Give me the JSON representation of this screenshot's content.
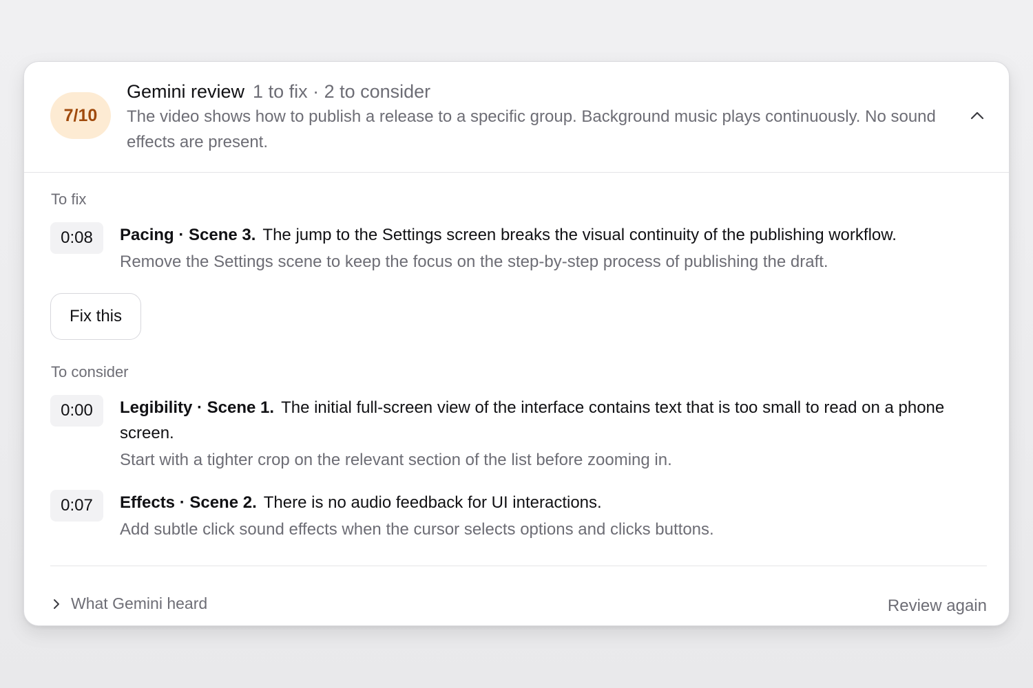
{
  "review": {
    "score": "7/10",
    "title": "Gemini review",
    "counts": "1 to fix · 2 to consider",
    "summary": "The video shows how to publish a release to a specific group. Background music plays continuously. No sound effects are present."
  },
  "to_fix": {
    "label": "To fix",
    "items": [
      {
        "timestamp": "0:08",
        "category": "Pacing · Scene 3.",
        "text": "The jump to the Settings screen breaks the visual continuity of the publishing workflow.",
        "suggestion": "Remove the Settings scene to keep the focus on the step-by-step process of publishing the draft."
      }
    ],
    "fix_button_label": "Fix this"
  },
  "to_consider": {
    "label": "To consider",
    "items": [
      {
        "timestamp": "0:00",
        "category": "Legibility · Scene 1.",
        "text": "The initial full-screen view of the interface contains text that is too small to read on a phone screen.",
        "suggestion": "Start with a tighter crop on the relevant section of the list before zooming in."
      },
      {
        "timestamp": "0:07",
        "category": "Effects · Scene 2.",
        "text": "There is no audio feedback for UI interactions.",
        "suggestion": "Add subtle click sound effects when the cursor selects options and clicks buttons."
      }
    ]
  },
  "footer": {
    "heard_label": "What Gemini heard",
    "review_again_label": "Review again"
  },
  "icons": {
    "collapse": "chevron-up-icon",
    "expand": "chevron-right-icon"
  },
  "colors": {
    "score_badge_bg": "#fdebd3",
    "score_badge_text": "#a04a0c",
    "muted_text": "#6d6d75",
    "primary_text": "#111114"
  }
}
